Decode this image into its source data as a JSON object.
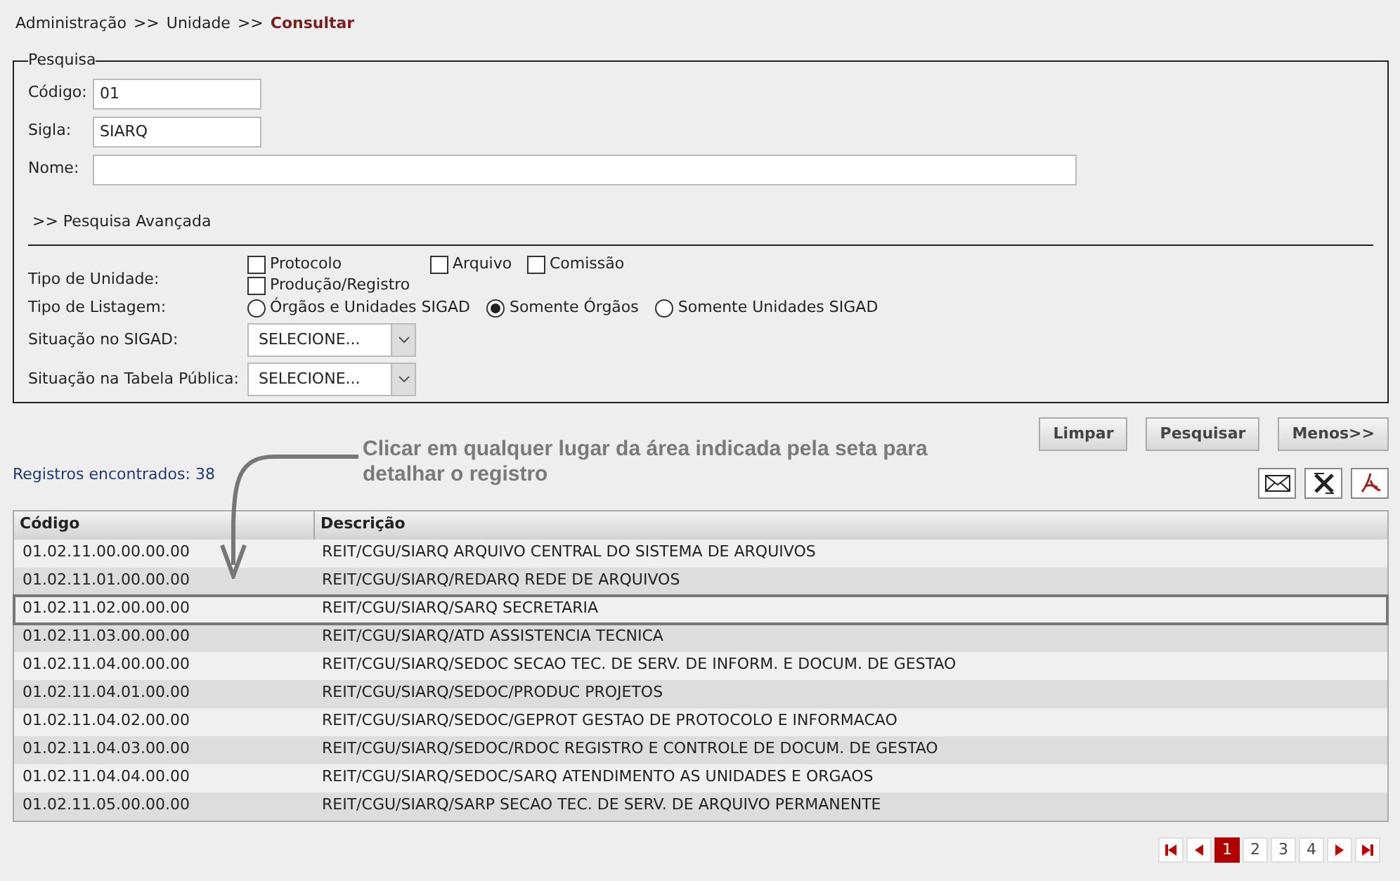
{
  "breadcrumb": [
    {
      "label": "Administração",
      "separator": ">>",
      "selected": false
    },
    {
      "label": "Unidade",
      "separator": ">>",
      "selected": false
    },
    {
      "label": "Consultar",
      "selected": true
    }
  ],
  "search": {
    "legend": "Pesquisa",
    "fields": [
      {
        "label": "Código:",
        "value": "01"
      },
      {
        "label": "Sigla:",
        "value": "SIARQ"
      },
      {
        "label": "Nome:"
      }
    ],
    "advanced_toggle": ">> Pesquisa Avançada",
    "unit_type": {
      "label": "Tipo de Unidade:",
      "options": [
        {
          "label": "Protocolo",
          "checked": false
        },
        {
          "label": "Arquivo",
          "checked": false
        },
        {
          "label": "Comissão",
          "checked": false
        },
        {
          "label": "Produção/Registro",
          "checked": false
        }
      ]
    },
    "listing_type": {
      "label": "Tipo de Listagem:",
      "options": [
        {
          "label": "Órgãos e Unidades SIGAD",
          "selected": false
        },
        {
          "label": "Somente Órgãos",
          "selected": true
        },
        {
          "label": "Somente Unidades SIGAD",
          "selected": false
        }
      ]
    },
    "selects": [
      {
        "label": "Situação no SIGAD:",
        "value": "SELECIONE..."
      },
      {
        "label": "Situação na Tabela Pública:",
        "value": "SELECIONE..."
      }
    ]
  },
  "buttons": [
    "Limpar",
    "Pesquisar",
    "Menos>>"
  ],
  "annotation": "Clicar em qualquer lugar da área indicada pela seta para detalhar o registro",
  "records_found": "Registros encontrados: 38",
  "table": {
    "columns": [
      "Código",
      "Descrição"
    ],
    "rows": [
      {
        "code": "01.02.11.00.00.00.00",
        "description": "REIT/CGU/SIARQ ARQUIVO CENTRAL DO SISTEMA DE ARQUIVOS",
        "selected": false
      },
      {
        "code": "01.02.11.01.00.00.00",
        "description": "REIT/CGU/SIARQ/REDARQ REDE DE ARQUIVOS",
        "selected": false
      },
      {
        "code": "01.02.11.02.00.00.00",
        "description": "REIT/CGU/SIARQ/SARQ SECRETARIA",
        "selected": true
      },
      {
        "code": "01.02.11.03.00.00.00",
        "description": "REIT/CGU/SIARQ/ATD ASSISTENCIA TECNICA",
        "selected": false
      },
      {
        "code": "01.02.11.04.00.00.00",
        "description": "REIT/CGU/SIARQ/SEDOC SECAO TEC. DE SERV. DE INFORM. E DOCUM. DE GESTAO",
        "selected": false
      },
      {
        "code": "01.02.11.04.01.00.00",
        "description": "REIT/CGU/SIARQ/SEDOC/PRODUC PROJETOS",
        "selected": false
      },
      {
        "code": "01.02.11.04.02.00.00",
        "description": "REIT/CGU/SIARQ/SEDOC/GEPROT GESTAO DE PROTOCOLO E INFORMACAO",
        "selected": false
      },
      {
        "code": "01.02.11.04.03.00.00",
        "description": "REIT/CGU/SIARQ/SEDOC/RDOC REGISTRO E CONTROLE DE DOCUM. DE GESTAO",
        "selected": false
      },
      {
        "code": "01.02.11.04.04.00.00",
        "description": "REIT/CGU/SIARQ/SEDOC/SARQ ATENDIMENTO AS UNIDADES E ORGAOS",
        "selected": false
      },
      {
        "code": "01.02.11.05.00.00.00",
        "description": "REIT/CGU/SIARQ/SARP SECAO TEC. DE SERV. DE ARQUIVO PERMANENTE",
        "selected": false
      }
    ]
  },
  "pagination": [
    {
      "label": "1",
      "selected": true
    },
    {
      "label": "2",
      "selected": false
    },
    {
      "label": "3",
      "selected": false
    },
    {
      "label": "4",
      "selected": false
    }
  ]
}
